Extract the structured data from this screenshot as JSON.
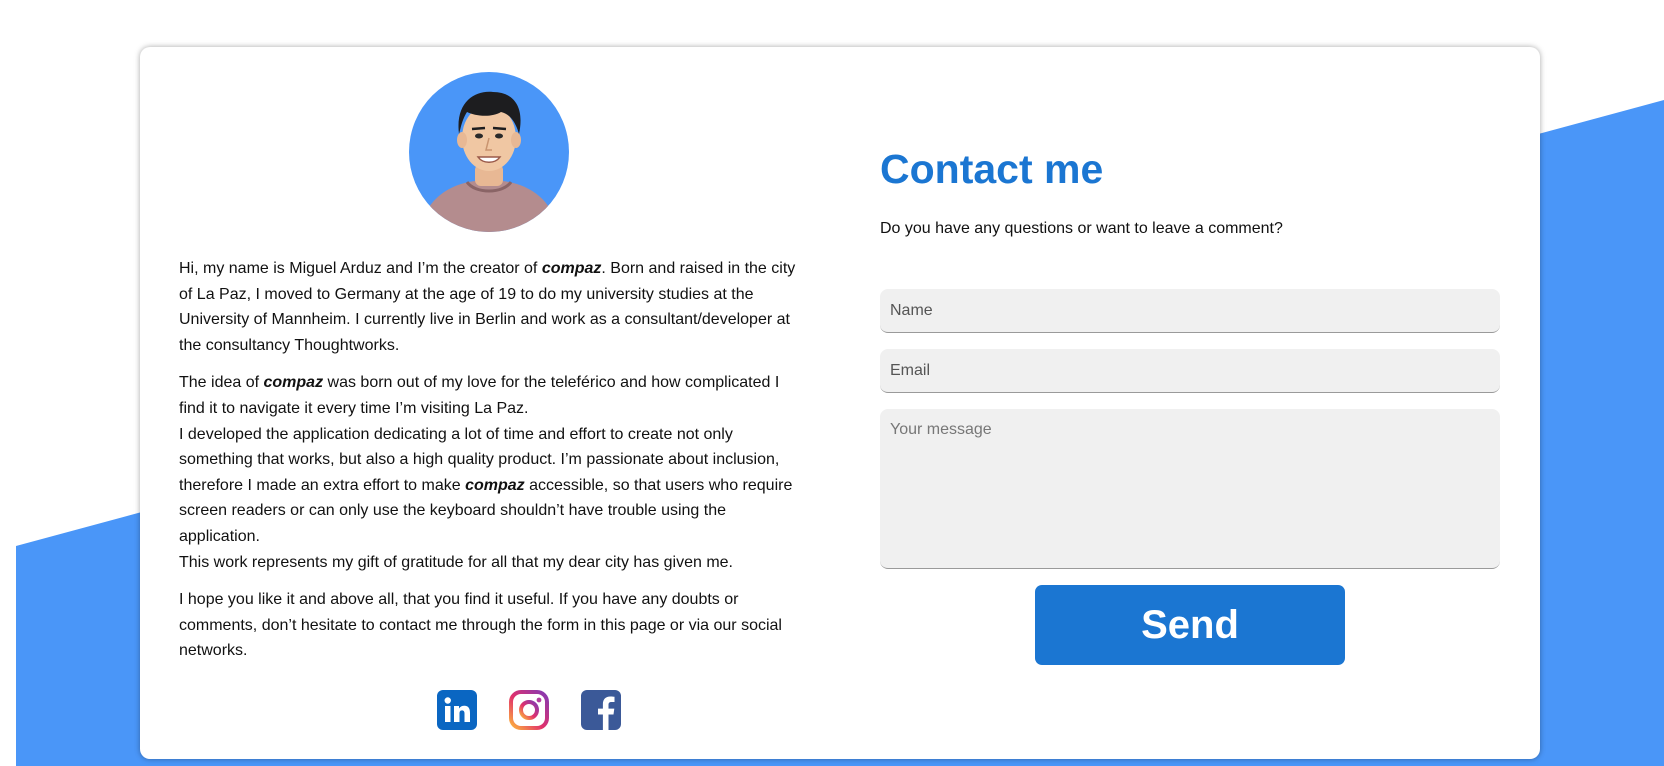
{
  "colors": {
    "accent": "#1b76d2",
    "background_shape": "#4a96f8",
    "input_bg": "#f0f0f0"
  },
  "bio": {
    "avatar_alt": "avatar-illustration",
    "p1_before": "Hi, my name is Miguel Arduz and I’m the creator of ",
    "brand": "compaz",
    "p1_after": ". Born and raised in the city of La Paz, I moved to Germany at the age of 19 to do my university studies at the University of Mannheim. I currently live in Berlin and work as a consultant/developer at the consultancy Thoughtworks.",
    "p2_before": "The idea of ",
    "p2_after": " was born out of my love for the teleférico and how complicated I find it to navigate it every time I’m visiting La Paz.",
    "p3_before": "I developed the application dedicating a lot of time and effort to create not only something that works, but also a high quality product. I’m passionate about inclusion, therefore I made an extra effort to make ",
    "p3_after": " accessible, so that users who require screen readers or can only use the keyboard shouldn’t have trouble using the application.",
    "p4": "This work represents my gift of gratitude for all that my dear city has given me.",
    "p5": "I hope you like it and above all, that you find it useful. If you have any doubts or comments, don’t hesitate to contact me through the form in this page or via our social networks."
  },
  "socials": [
    {
      "icon": "linkedin-icon"
    },
    {
      "icon": "instagram-icon"
    },
    {
      "icon": "facebook-icon"
    }
  ],
  "contact": {
    "title": "Contact me",
    "subtitle": "Do you have any questions or want to leave a comment?",
    "name_placeholder": "Name",
    "email_placeholder": "Email",
    "message_placeholder": "Your message",
    "send_label": "Send"
  }
}
